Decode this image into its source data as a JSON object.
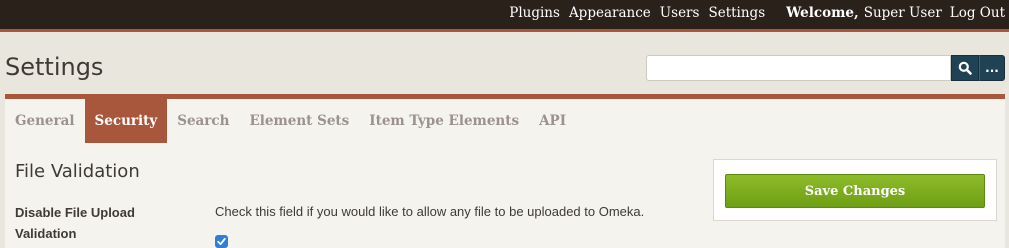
{
  "topnav": {
    "links": [
      "Plugins",
      "Appearance",
      "Users",
      "Settings"
    ],
    "welcome_label": "Welcome,",
    "user_name": "Super User",
    "logout_label": "Log Out"
  },
  "page": {
    "title": "Settings"
  },
  "search": {
    "value": "",
    "more_label": "..."
  },
  "tabs": [
    "General",
    "Security",
    "Search",
    "Element Sets",
    "Item Type Elements",
    "API"
  ],
  "active_tab": "Security",
  "section": {
    "title": "File Validation",
    "field_label": "Disable File Upload Validation",
    "field_description": "Check this field if you would like to allow any file to be uploaded to Omeka.",
    "checked": true
  },
  "save": {
    "label": "Save Changes"
  },
  "colors": {
    "topbar": "#2b211b",
    "accent": "#a9573c",
    "save_green": "#7aab1c",
    "search_blue": "#1f4254"
  }
}
